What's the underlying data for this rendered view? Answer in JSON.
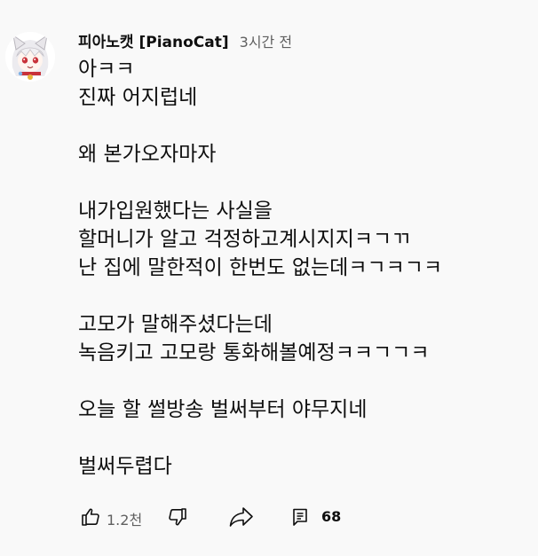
{
  "comment": {
    "author": "피아노캣 [PianoCat]",
    "timestamp": "3시간 전",
    "lines": [
      "아ㅋㅋ",
      "진짜 어지럽네",
      "",
      "왜 본가오자마자",
      "",
      "내가입원했다는 사실을",
      "할머니가 알고 걱정하고계시지지ㅋㄱㄲ",
      "난 집에 말한적이 한번도 없는데ㅋㄱㅋㄱㅋ",
      "",
      "고모가 말해주셨다는데",
      "녹음키고 고모랑 통화해볼예정ㅋㅋㄱㄱㅋ",
      "",
      "오늘 할 썰방송 벌써부터 야무지네",
      "",
      "벌써두렵다"
    ],
    "like_count": "1.2천",
    "reply_count": "68"
  },
  "icons": {
    "avatar": "white-haired-anime-avatar",
    "like": "thumbs-up-icon",
    "dislike": "thumbs-down-icon",
    "share": "share-arrow-icon",
    "reply": "reply-comment-icon"
  },
  "colors": {
    "background": "#f9f9f9",
    "text": "#0f0f0f",
    "secondary_text": "#606060"
  }
}
